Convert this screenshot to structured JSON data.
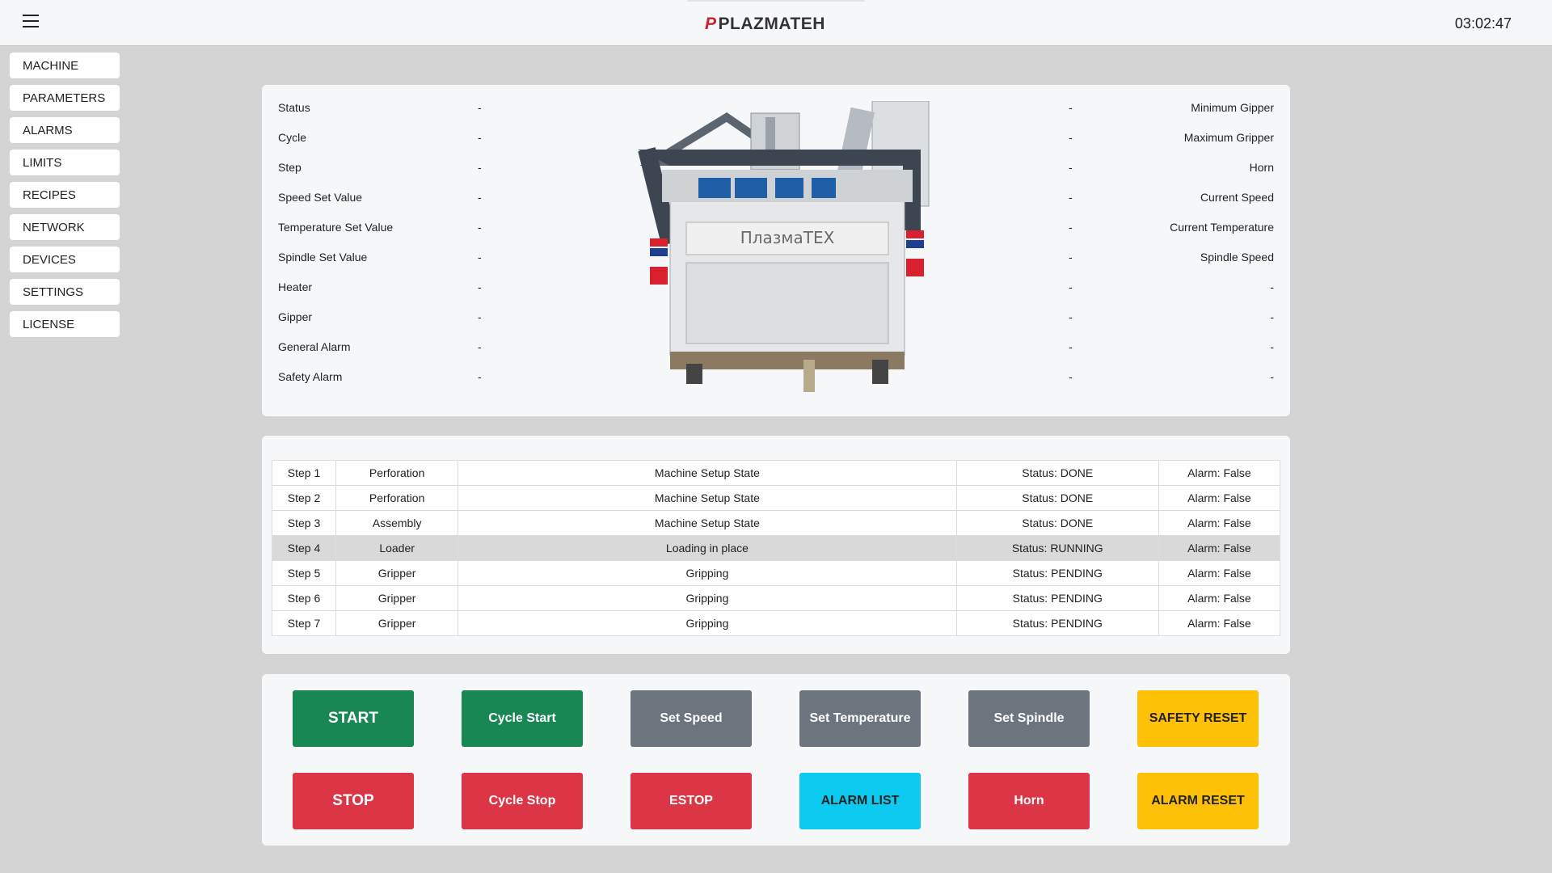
{
  "header": {
    "brand_mark": "P",
    "brand_text": "PLAZMATEH",
    "clock": "03:02:47"
  },
  "sidebar": {
    "items": [
      {
        "label": "MACHINE"
      },
      {
        "label": "PARAMETERS"
      },
      {
        "label": "ALARMS"
      },
      {
        "label": "LIMITS"
      },
      {
        "label": "RECIPES"
      },
      {
        "label": "NETWORK"
      },
      {
        "label": "DEVICES"
      },
      {
        "label": "SETTINGS"
      },
      {
        "label": "LICENSE"
      }
    ]
  },
  "status": {
    "left": [
      {
        "label": "Status",
        "value": "-"
      },
      {
        "label": "Cycle",
        "value": "-"
      },
      {
        "label": "Step",
        "value": "-"
      },
      {
        "label": "Speed Set Value",
        "value": "-"
      },
      {
        "label": "Temperature Set Value",
        "value": "-"
      },
      {
        "label": "Spindle Set Value",
        "value": "-"
      },
      {
        "label": "Heater",
        "value": "-"
      },
      {
        "label": "Gipper",
        "value": "-"
      },
      {
        "label": "General Alarm",
        "value": "-"
      },
      {
        "label": "Safety Alarm",
        "value": "-"
      }
    ],
    "right": [
      {
        "label": "Minimum Gipper",
        "value": "-"
      },
      {
        "label": "Maximum Gripper",
        "value": "-"
      },
      {
        "label": "Horn",
        "value": "-"
      },
      {
        "label": "Current Speed",
        "value": "-"
      },
      {
        "label": "Current Temperature",
        "value": "-"
      },
      {
        "label": "Spindle Speed",
        "value": "-"
      },
      {
        "label": "-",
        "value": "-"
      },
      {
        "label": "-",
        "value": "-"
      },
      {
        "label": "-",
        "value": "-"
      },
      {
        "label": "-",
        "value": "-"
      }
    ],
    "machine_logo_text": "ПлазмаТЕХ"
  },
  "steps": [
    {
      "step": "Step 1",
      "unit": "Perforation",
      "state": "Machine Setup State",
      "status": "Status: DONE",
      "alarm": "Alarm: False",
      "active": false
    },
    {
      "step": "Step 2",
      "unit": "Perforation",
      "state": "Machine Setup State",
      "status": "Status: DONE",
      "alarm": "Alarm: False",
      "active": false
    },
    {
      "step": "Step 3",
      "unit": "Assembly",
      "state": "Machine Setup State",
      "status": "Status: DONE",
      "alarm": "Alarm: False",
      "active": false
    },
    {
      "step": "Step 4",
      "unit": "Loader",
      "state": "Loading in place",
      "status": "Status: RUNNING",
      "alarm": "Alarm: False",
      "active": true
    },
    {
      "step": "Step 5",
      "unit": "Gripper",
      "state": "Gripping",
      "status": "Status: PENDING",
      "alarm": "Alarm: False",
      "active": false
    },
    {
      "step": "Step 6",
      "unit": "Gripper",
      "state": "Gripping",
      "status": "Status: PENDING",
      "alarm": "Alarm: False",
      "active": false
    },
    {
      "step": "Step 7",
      "unit": "Gripper",
      "state": "Gripping",
      "status": "Status: PENDING",
      "alarm": "Alarm: False",
      "active": false
    }
  ],
  "buttons": {
    "row1": [
      {
        "label": "START",
        "color": "green"
      },
      {
        "label": "Cycle Start",
        "color": "green"
      },
      {
        "label": "Set Speed",
        "color": "gray"
      },
      {
        "label": "Set Temperature",
        "color": "gray"
      },
      {
        "label": "Set Spindle",
        "color": "gray"
      },
      {
        "label": "SAFETY RESET",
        "color": "yellow"
      }
    ],
    "row2": [
      {
        "label": "STOP",
        "color": "red"
      },
      {
        "label": "Cycle Stop",
        "color": "red"
      },
      {
        "label": "ESTOP",
        "color": "red"
      },
      {
        "label": "ALARM LIST",
        "color": "cyan"
      },
      {
        "label": "Horn",
        "color": "red"
      },
      {
        "label": "ALARM RESET",
        "color": "yellow"
      }
    ]
  },
  "colors": {
    "green": "#198754",
    "gray": "#6c757d",
    "yellow": "#ffc107",
    "red": "#dc3545",
    "cyan": "#0dcaf0",
    "active_row": "#d9d9d9"
  }
}
